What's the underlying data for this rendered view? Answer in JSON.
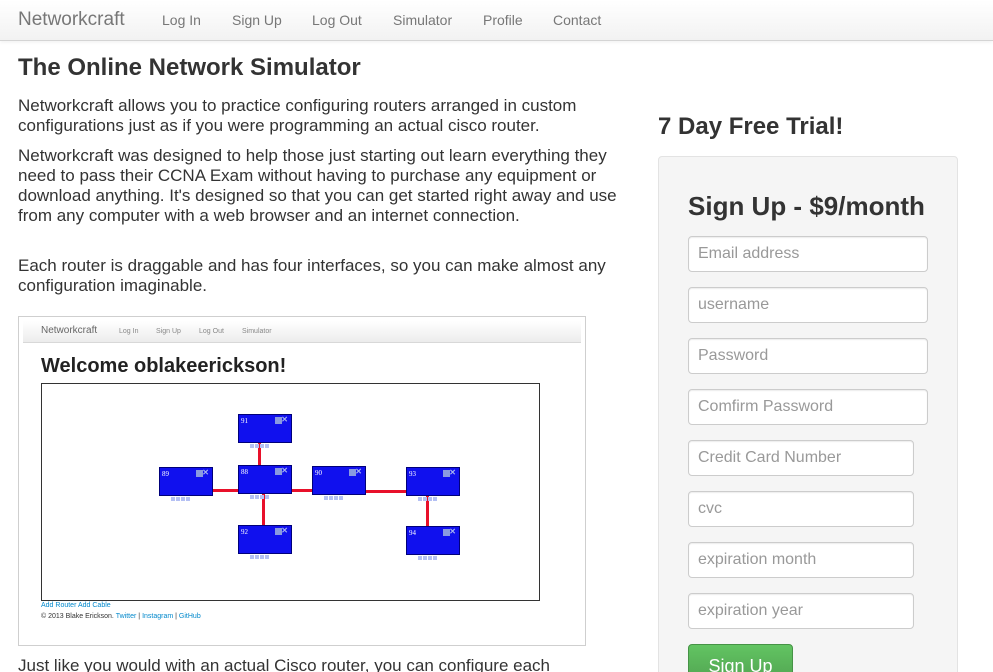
{
  "navbar": {
    "brand": "Networkcraft",
    "items": [
      {
        "label": "Log In"
      },
      {
        "label": "Sign Up"
      },
      {
        "label": "Log Out"
      },
      {
        "label": "Simulator"
      },
      {
        "label": "Profile"
      },
      {
        "label": "Contact"
      }
    ]
  },
  "main": {
    "title": "The Online Network Simulator",
    "paragraphs": [
      "Networkcraft allows you to practice configuring routers arranged in custom configurations just as if you were programming an actual cisco router.",
      "Networkcraft was designed to help those just starting out learn everything they need to pass their CCNA Exam without having to purchase any equipment or download anything. It's designed so that you can get started right away and use from any computer with a web browser and an internet connection.",
      "Each router is draggable and has four interfaces, so you can make almost any configuration imaginable."
    ],
    "bottom_paragraph": "Just like you would with an actual Cisco router, you can configure each"
  },
  "screenshot": {
    "nav_brand": "Networkcraft",
    "nav_links": [
      "Log In",
      "Sign Up",
      "Log Out",
      "Simulator"
    ],
    "welcome": "Welcome oblakeerickson!",
    "routers": [
      {
        "label": "91"
      },
      {
        "label": "89"
      },
      {
        "label": "88"
      },
      {
        "label": "90"
      },
      {
        "label": "93"
      },
      {
        "label": "92"
      },
      {
        "label": "94"
      }
    ],
    "actions": "Add Router Add Cable",
    "footer_text": "© 2013 Blake Erickson.",
    "footer_links": [
      "Twitter",
      "Instagram",
      "GitHub"
    ],
    "footer_sep": "|"
  },
  "sidebar": {
    "trial_title": "7 Day Free Trial!",
    "signup_title": "Sign Up - $9/month",
    "fields": {
      "email": "Email address",
      "username": "username",
      "password": "Password",
      "confirm": "Comfirm Password",
      "card": "Credit Card Number",
      "cvc": "cvc",
      "exp_month": "expiration month",
      "exp_year": "expiration year"
    },
    "button": "Sign Up"
  },
  "colors": {
    "router_fill": "#1010ee",
    "cable": "#e8102a",
    "signup_button": "#5bb75b",
    "link": "#0088cc"
  }
}
